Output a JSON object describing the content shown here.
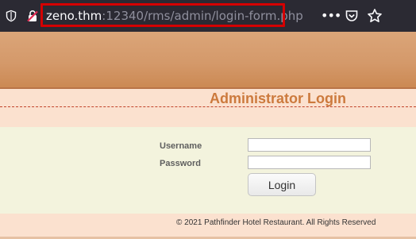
{
  "browser": {
    "url_host": "zeno.thm",
    "url_rest": ":12340/rms/admin/login-form.php",
    "icons": [
      "shield-icon",
      "insecure-lock-icon",
      "more-icon",
      "pocket-icon",
      "bookmark-star-icon"
    ]
  },
  "page": {
    "title": "Administrator Login",
    "form": {
      "username_label": "Username",
      "password_label": "Password",
      "username_value": "",
      "password_value": "",
      "login_label": "Login"
    },
    "footer": "© 2021 Pathfinder Hotel Restaurant. All Rights Reserved"
  },
  "colors": {
    "toolbar": "#2b2a33",
    "banner": "#d4996a",
    "title": "#cc7a3d",
    "form_bg": "#f3f3dd",
    "band": "#fbe1cf",
    "url_highlight": "#d50000"
  }
}
